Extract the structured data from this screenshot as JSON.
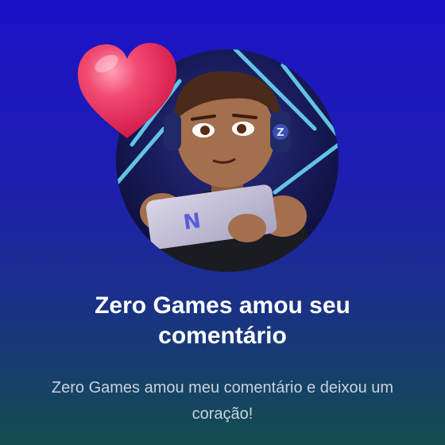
{
  "notification": {
    "title": "Zero Games amou seu comentário",
    "message": "Zero Games amou meu comentário e deixou um coração!"
  },
  "avatar": {
    "icon": "gamer-avatar-illustration",
    "phone_logo_letter": "N",
    "headset_logo_letter": "Z"
  },
  "reaction": {
    "icon": "heart-icon"
  },
  "colors": {
    "background_top": "#1a12c8",
    "background_bottom": "#134d4d",
    "heart": "#f0305a",
    "title_text": "#ffffff",
    "message_text": "#c9d2dc"
  }
}
